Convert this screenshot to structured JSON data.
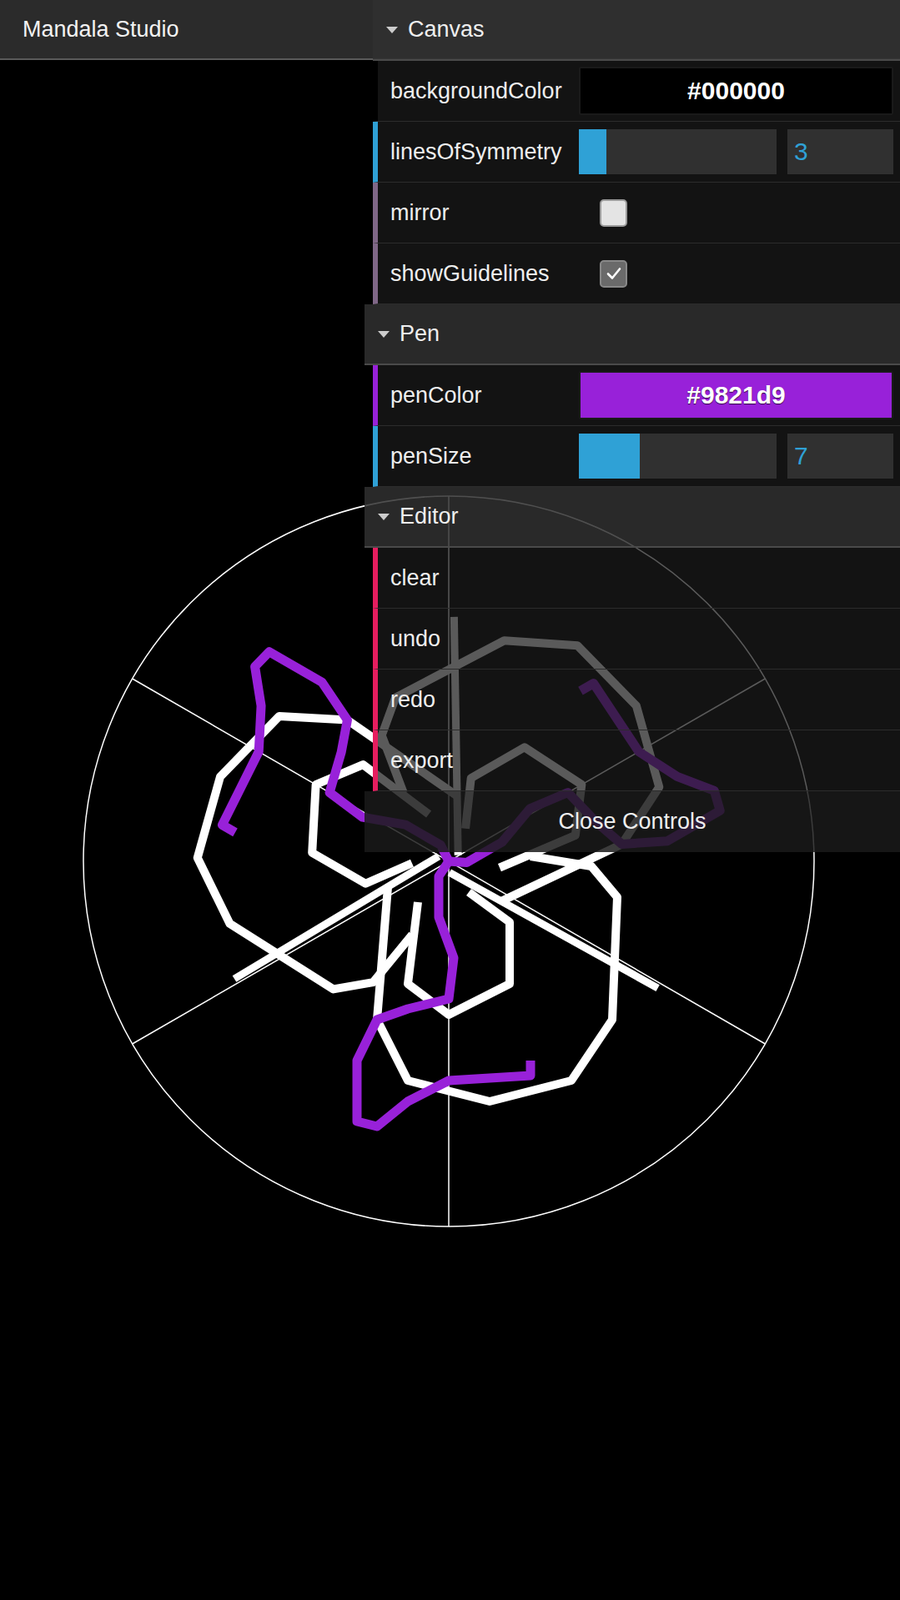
{
  "app": {
    "title": "Mandala Studio"
  },
  "controls": {
    "folders": [
      {
        "title": "Canvas",
        "expanded": true,
        "items": [
          {
            "kind": "color",
            "label": "backgroundColor",
            "value": "#000000",
            "color": "#000000"
          },
          {
            "kind": "slider",
            "label": "linesOfSymmetry",
            "value": "3",
            "level": 0.14
          },
          {
            "kind": "checkbox",
            "label": "mirror",
            "checked": false
          },
          {
            "kind": "checkbox",
            "label": "showGuidelines",
            "checked": true
          }
        ]
      },
      {
        "title": "Pen",
        "expanded": true,
        "items": [
          {
            "kind": "color",
            "label": "penColor",
            "value": "#9821d9",
            "color": "#9821d9"
          },
          {
            "kind": "slider",
            "label": "penSize",
            "value": "7",
            "level": 0.31
          }
        ]
      },
      {
        "title": "Editor",
        "expanded": true,
        "items": [
          {
            "kind": "button",
            "label": "clear"
          },
          {
            "kind": "button",
            "label": "undo"
          },
          {
            "kind": "button",
            "label": "redo"
          },
          {
            "kind": "button",
            "label": "export"
          }
        ]
      }
    ],
    "close": "Close Controls"
  },
  "canvas": {
    "strokes": [
      {
        "color": "#ffffff",
        "width": 10,
        "points": [
          [
            -73,
            31
          ],
          [
            -86,
            190
          ],
          [
            -49,
            263
          ],
          [
            49,
            288
          ],
          [
            147,
            263
          ],
          [
            196,
            190
          ],
          [
            202,
            43
          ],
          [
            171,
            6
          ],
          [
            98,
            -6
          ]
        ]
      },
      {
        "color": "#ffffff",
        "width": 10,
        "points": [
          [
            -37,
            49
          ],
          [
            -49,
            147
          ],
          [
            0,
            184
          ],
          [
            73,
            147
          ],
          [
            73,
            73
          ],
          [
            24,
            37
          ]
        ]
      },
      {
        "color": "#ffffff",
        "width": 9,
        "points": [
          [
            -257,
            141
          ],
          [
            -12,
            -6
          ]
        ]
      },
      {
        "color": "#9821d9",
        "width": 11,
        "points": [
          [
            98,
            239
          ],
          [
            98,
            257
          ],
          [
            0,
            263
          ],
          [
            -49,
            288
          ],
          [
            -86,
            318
          ],
          [
            -110,
            312
          ],
          [
            -110,
            239
          ],
          [
            -86,
            190
          ],
          [
            -49,
            177
          ],
          [
            0,
            165
          ],
          [
            6,
            116
          ],
          [
            -12,
            67
          ],
          [
            -12,
            18
          ],
          [
            0,
            0
          ]
        ]
      }
    ]
  }
}
